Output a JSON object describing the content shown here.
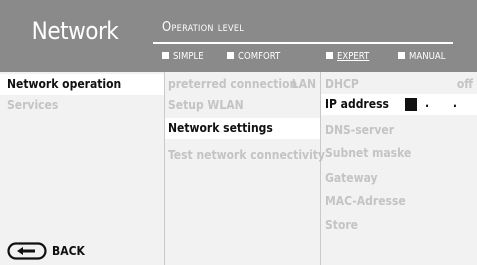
{
  "header": {
    "title": "Network",
    "operation_level_label": "Operation level",
    "levels": [
      {
        "label": "SIMPLE",
        "active": false
      },
      {
        "label": "COMFORT",
        "active": false
      },
      {
        "label": "EXPERT",
        "active": true
      },
      {
        "label": "MANUAL",
        "active": false
      }
    ]
  },
  "menu": {
    "items": [
      {
        "label": "Network operation",
        "state": "selected"
      },
      {
        "label": "Services",
        "state": "dim"
      }
    ],
    "back_label": "BACK",
    "back_icon": "back-arrow-icon"
  },
  "submenu": {
    "items": [
      {
        "label": "preterred connection",
        "value": "LAN",
        "state": "dim"
      },
      {
        "label": "Setup WLAN",
        "state": "dim"
      },
      {
        "label": "Network settings",
        "state": "highlighted"
      },
      {
        "label": "Test network connectivity",
        "state": "dim"
      }
    ]
  },
  "settings": {
    "items": [
      {
        "label": "DHCP",
        "value": "off",
        "state": "dim"
      },
      {
        "label": "IP address",
        "value": ". . .",
        "state": "highlighted"
      },
      {
        "label": "DNS-server",
        "state": "dim"
      },
      {
        "label": "Subnet maske",
        "state": "dim"
      },
      {
        "label": "Gateway",
        "state": "dim"
      },
      {
        "label": "MAC-Adresse",
        "state": "dim"
      },
      {
        "label": "Store",
        "state": "dim"
      }
    ]
  },
  "colors": {
    "header_bg": "#8a8a8a",
    "body_bg": "#f2f2f2",
    "highlight_bg": "#ffffff",
    "dim_text": "#c4c4c4",
    "active_text": "#111111"
  }
}
